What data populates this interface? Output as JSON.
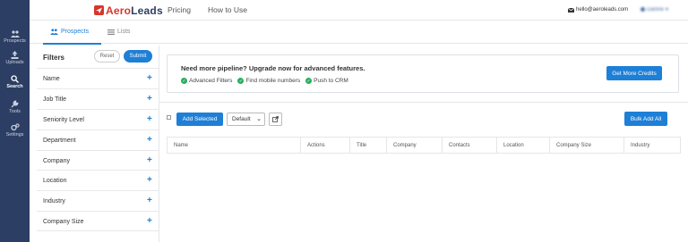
{
  "sidebar": {
    "items": [
      {
        "label": "Prospects",
        "icon": "people-icon"
      },
      {
        "label": "Uploads",
        "icon": "upload-icon"
      },
      {
        "label": "Search",
        "icon": "search-icon"
      },
      {
        "label": "Tools",
        "icon": "wrench-icon"
      },
      {
        "label": "Settings",
        "icon": "gear-icon"
      }
    ],
    "active": "Search"
  },
  "topbar": {
    "logo_part1": "Aero",
    "logo_part2": "Leads",
    "nav": [
      "Pricing",
      "How to Use"
    ],
    "email": "hello@aeroleads.com",
    "user_name": "Darline"
  },
  "tabs": [
    {
      "label": "Prospects",
      "active": true
    },
    {
      "label": "Lists",
      "active": false
    }
  ],
  "filters": {
    "title": "Filters",
    "reset_label": "Reset",
    "submit_label": "Submit",
    "items": [
      "Name",
      "Job Title",
      "Seniority Level",
      "Department",
      "Company",
      "Location",
      "Industry",
      "Company Size"
    ]
  },
  "upgrade": {
    "title": "Need more pipeline? Upgrade now for advanced features.",
    "features": [
      "Advanced Filters",
      "Find mobile numbers",
      "Push to CRM"
    ],
    "button_label": "Get More Credits"
  },
  "toolbar": {
    "add_selected_label": "Add Selected",
    "default_select_value": "Default",
    "bulk_add_label": "Bulk Add All"
  },
  "table": {
    "columns": [
      "Name",
      "Actions",
      "Title",
      "Company",
      "Contacts",
      "Location",
      "Company Size",
      "Industry"
    ]
  },
  "colors": {
    "sidebar_bg": "#2c3e63",
    "accent_blue": "#1e7fd6",
    "brand_red": "#d9352b",
    "check_green": "#27ae60"
  }
}
